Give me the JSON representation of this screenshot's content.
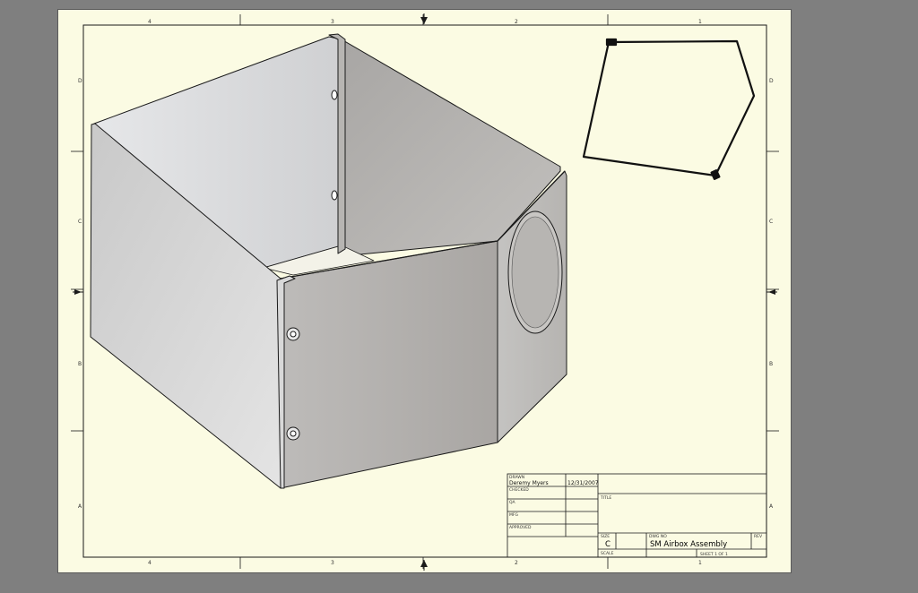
{
  "sheet": {
    "zones_top": [
      "4",
      "3",
      "2",
      "1"
    ],
    "zones_bottom": [
      "4",
      "3",
      "2",
      "1"
    ],
    "zones_left": [
      "D",
      "C",
      "B",
      "A"
    ],
    "zones_right": [
      "D",
      "C",
      "B",
      "A"
    ]
  },
  "title_block": {
    "drawn_label": "DRAWN",
    "drawn_by": "Deremy Myers",
    "drawn_date": "12/31/2007",
    "checked_label": "CHECKED",
    "qa_label": "QA",
    "mfg_label": "MFG",
    "approved_label": "APPROVED",
    "title_label": "TITLE",
    "size_label": "SIZE",
    "size_value": "C",
    "dwg_no_label": "DWG NO",
    "dwg_no_value": "SM Airbox Assembly",
    "rev_label": "REV",
    "scale_label": "SCALE",
    "sheet_text": "SHEET 1  OF 1"
  },
  "colors": {
    "sheet": "#fbfbe3",
    "background": "#7f7f7f",
    "line": "#1a1a1a"
  }
}
